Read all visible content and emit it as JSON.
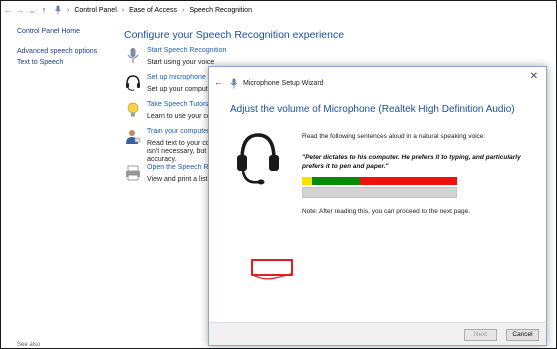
{
  "address_bar": {
    "crumbs": [
      "Control Panel",
      "Ease of Access",
      "Speech Recognition"
    ]
  },
  "leftnav": {
    "home": "Control Panel Home",
    "links": [
      "Advanced speech options",
      "Text to Speech"
    ],
    "see_also": "See also"
  },
  "main": {
    "title": "Configure your Speech Recognition experience",
    "options": [
      {
        "title": "Start Speech Recognition",
        "desc": "Start using your voice",
        "icon": "microphone-icon"
      },
      {
        "title": "Set up microphone",
        "desc": "Set up your computer",
        "icon": "headset-icon"
      },
      {
        "title": "Take Speech Tutorial",
        "desc": "Learn to use your computer",
        "icon": "lightbulb-icon"
      },
      {
        "title": "Train your computer",
        "desc1": "Read text to your computer",
        "desc2": "isn't necessary, but can",
        "desc3": "accuracy.",
        "icon": "user-training-icon"
      },
      {
        "title": "Open the Speech Reference Card",
        "desc": "View and print a list of",
        "icon": "printer-icon"
      }
    ]
  },
  "dialog": {
    "title": "Microphone Setup Wizard",
    "heading": "Adjust the volume of Microphone (Realtek High Definition Audio)",
    "instruction": "Read the following sentences aloud in a natural speaking voice:",
    "quote": "\"Peter dictates to his computer. He prefers it to typing, and particularly prefers it to pen and paper.\"",
    "note": "Note: After reading this, you can proceed to the next page.",
    "next_label": "Next",
    "cancel_label": "Cancel",
    "volume_colors": {
      "low": "#f2e600",
      "mid": "#0a8a0a",
      "high": "#ee1111"
    },
    "volume_level": 1.0
  }
}
